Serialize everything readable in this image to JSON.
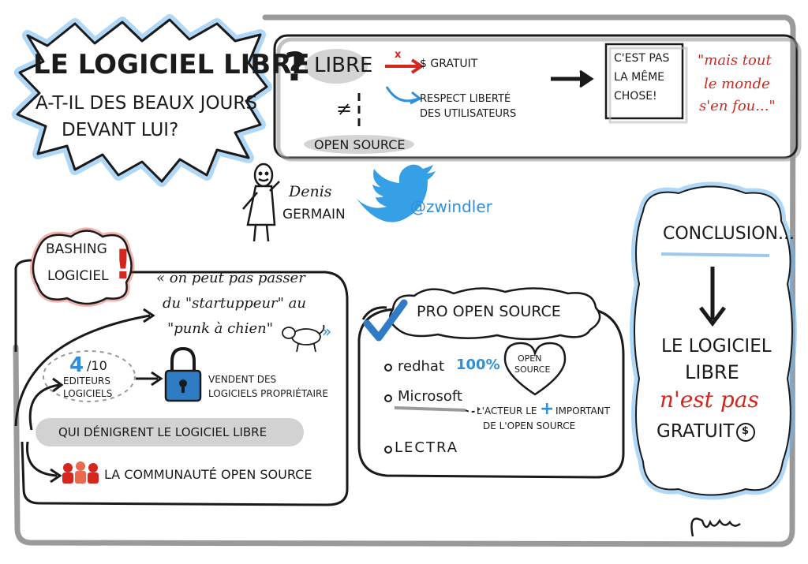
{
  "title_block": {
    "line1": "LE LOGICIEL LIBRE",
    "line2": "A-T-IL DES BEAUX JOURS",
    "line3": "DEVANT LUI?"
  },
  "top_panel": {
    "question_mark": "?",
    "libre": "LIBRE",
    "cross_mark": "x",
    "gratuit": "$ GRATUIT",
    "respect": "RESPECT LIBERTÉ",
    "users": "DES UTILISATEURS",
    "not_equal": "≠",
    "open_source": "OPEN SOURCE",
    "note_l1": "C'EST PAS",
    "note_l2": "LA MÊME",
    "note_l3": "CHOSE!",
    "quote_l1": "\"mais tout",
    "quote_l2": "le monde",
    "quote_l3": "s'en fou...\""
  },
  "speaker": {
    "first": "Denis",
    "last": "GERMAIN",
    "handle": "@zwindler"
  },
  "bashing": {
    "label_l1": "BASHING",
    "label_l2": "LOGICIEL",
    "exclaim": "!",
    "quote_l1": "« on peut pas passer",
    "quote_l2": "du \"startuppeur\" au",
    "quote_l3": "\"punk à chien\"",
    "quote_close": "»",
    "stat": "4",
    "stat_den": "/10",
    "editors_l1": "EDITEURS",
    "editors_l2": "LOGICIELS",
    "sell_l1": "VENDENT DES",
    "sell_l2": "LOGICIELS PROPRIÉTAIRE",
    "denigrate": "QUI DÉNIGRENT LE LOGICIEL LIBRE",
    "community": "LA COMMUNAUTÉ OPEN SOURCE"
  },
  "pro_open_source": {
    "title": "PRO OPEN SOURCE",
    "redhat": "redhat",
    "percent": "100%",
    "heart_l1": "OPEN",
    "heart_l2": "SOURCE",
    "microsoft": "Microsoft",
    "actor_l1": "L'ACTEUR LE",
    "plus": "+",
    "actor_l1b": "IMPORTANT",
    "actor_l2": "DE L'OPEN SOURCE",
    "lectra": "LECTRA"
  },
  "conclusion": {
    "title": "CONCLUSION...",
    "l1": "LE LOGICIEL",
    "l2": "LIBRE",
    "l3": "n'est pas",
    "l4": "GRATUIT",
    "dollar": "$"
  },
  "colors": {
    "red": "#d5261e",
    "blue": "#2f8fd8",
    "gray_frame": "#9a9a9a",
    "shadow_gray": "#c9c9c9"
  }
}
